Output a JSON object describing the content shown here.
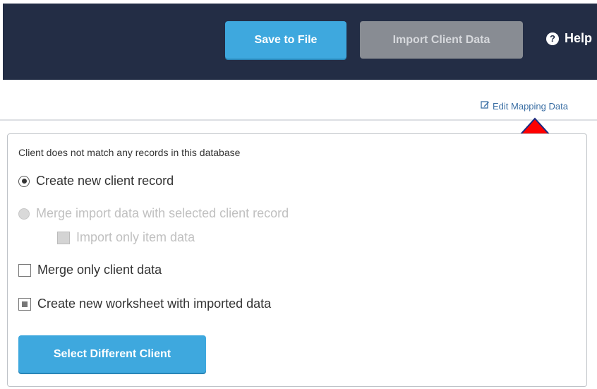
{
  "toolbar": {
    "save_label": "Save to File",
    "import_label": "Import Client Data",
    "help_label": "Help"
  },
  "mapping": {
    "edit_label": "Edit Mapping Data"
  },
  "panel": {
    "message": "Client does not match any records in this database",
    "options": {
      "create_new": "Create new client record",
      "merge_import": "Merge import data with selected client record",
      "import_item_only": "Import only item data",
      "merge_client_only": "Merge only client data",
      "new_worksheet": "Create new worksheet with imported data"
    },
    "select_label": "Select Different Client"
  },
  "colors": {
    "header_bg": "#232d45",
    "primary": "#3ea8de",
    "disabled_button": "#888c93",
    "link": "#3b6fa4",
    "annotation_arrow": "#ff0000"
  }
}
